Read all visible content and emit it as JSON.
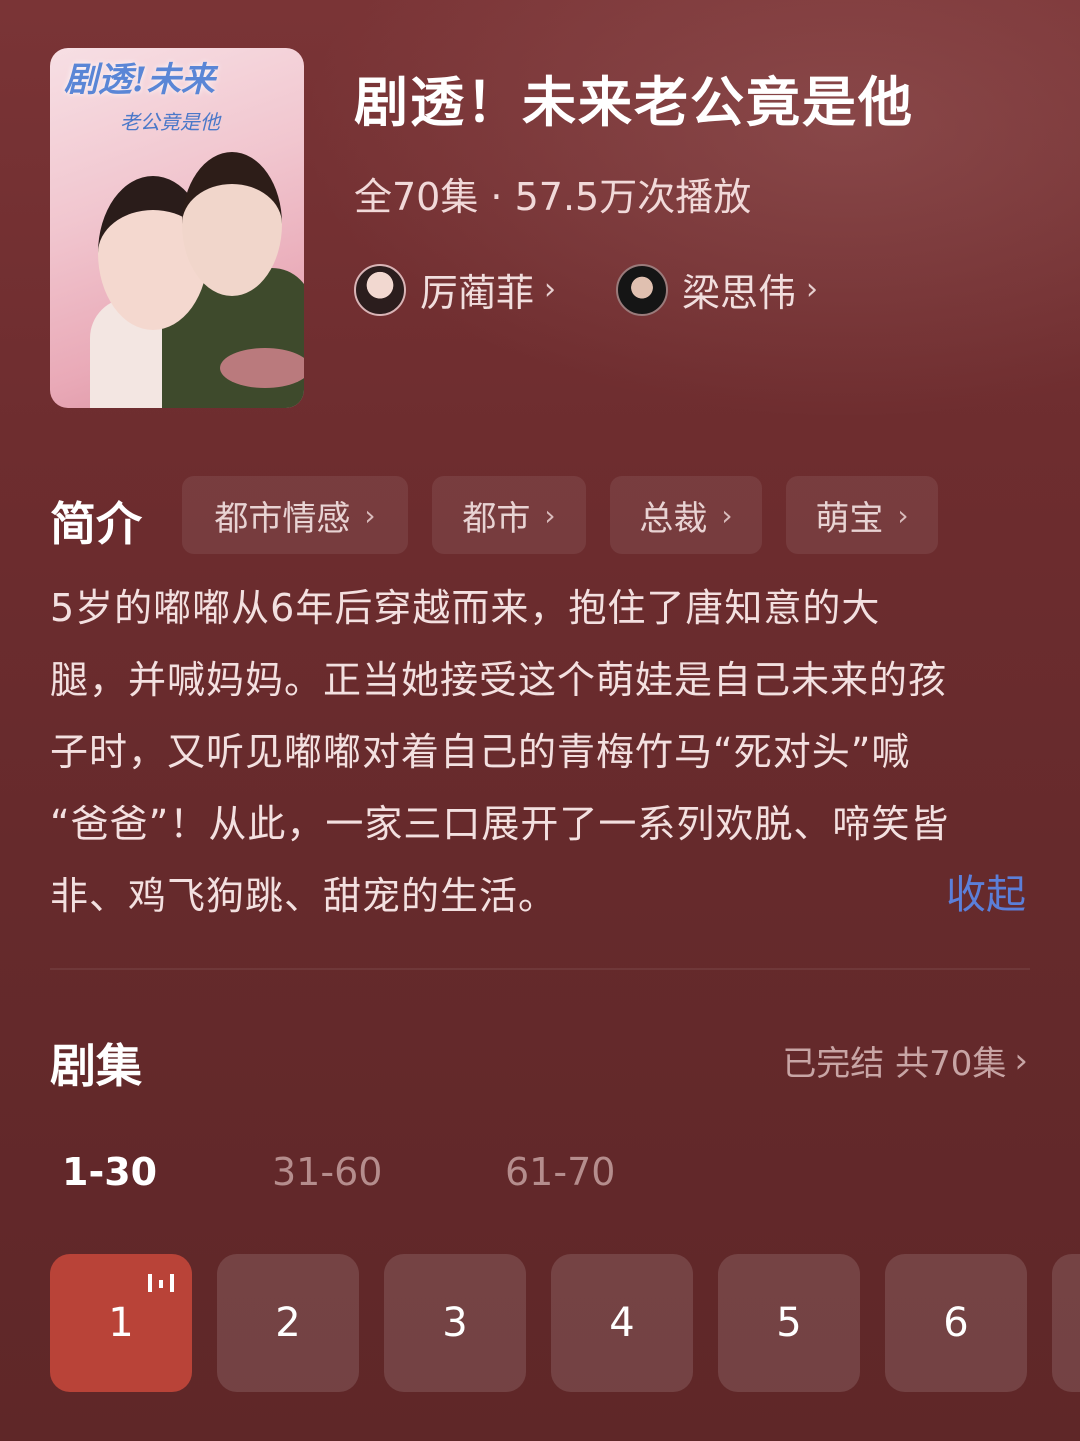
{
  "poster": {
    "title_art": "剧透!未来",
    "subtitle_art": "老公竟是他"
  },
  "drama": {
    "title": "剧透！未来老公竟是他",
    "meta": "全70集 · 57.5万次播放",
    "actors": [
      {
        "name": "厉蔺菲"
      },
      {
        "name": "梁思伟"
      }
    ]
  },
  "intro": {
    "heading": "简介",
    "tags": [
      "都市情感",
      "都市",
      "总裁",
      "萌宝"
    ],
    "lines": [
      "5岁的嘟嘟从6年后穿越而来，抱住了唐知意的大",
      "腿，并喊妈妈。正当她接受这个萌娃是自己未来的孩",
      "子时，又听见嘟嘟对着自己的青梅竹马“死对头”喊",
      "“爸爸”！从此，一家三口展开了一系列欢脱、啼笑皆",
      "非、鸡飞狗跳、甜宠的生活。"
    ],
    "collapse_label": "收起"
  },
  "episodes": {
    "heading": "剧集",
    "status": "已完结 共70集",
    "ranges": [
      "1-30",
      "31-60",
      "61-70"
    ],
    "active_range": "1-30",
    "items": [
      "1",
      "2",
      "3",
      "4",
      "5",
      "6"
    ],
    "active_item": "1"
  },
  "colors": {
    "accent_active": "#b94338",
    "link_blue": "#5b7fd9"
  }
}
